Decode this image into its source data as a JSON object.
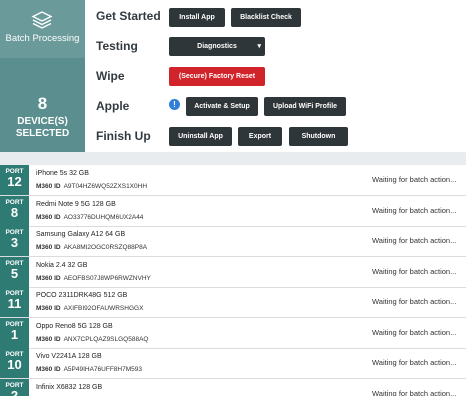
{
  "sidebar": {
    "app_label": "Batch Processing",
    "device_count": "8",
    "device_label_line1": "DEVICE(S)",
    "device_label_line2": "SELECTED"
  },
  "actions": {
    "get_started": {
      "label": "Get Started",
      "install_app": "Install App",
      "blacklist_check": "Blacklist Check"
    },
    "testing": {
      "label": "Testing",
      "diagnostics": "Diagnostics"
    },
    "wipe": {
      "label": "Wipe",
      "factory_reset": "(Secure) Factory Reset"
    },
    "apple": {
      "label": "Apple",
      "info": "!",
      "activate_setup": "Activate & Setup",
      "upload_wifi": "Upload WiFi Profile"
    },
    "finish_up": {
      "label": "Finish Up",
      "uninstall_app": "Uninstall App",
      "export": "Export",
      "shutdown": "Shutdown"
    }
  },
  "colors": {
    "sidebar": "#5b8e8e",
    "port_badge": "#2e7b74",
    "button_dark": "#2f3639",
    "button_danger": "#d0232a",
    "info_blue": "#2f7fd6"
  },
  "device_list": {
    "port_label": "PORT",
    "id_label": "M360 ID",
    "devices": [
      {
        "port": "12",
        "name": "iPhone 5s 32 GB",
        "id": "A9T04HZ6WQ52ZXS1X0HH",
        "status": "Waiting for batch action..."
      },
      {
        "port": "8",
        "name": "Redmi Note 9 5G 128 GB",
        "id": "AO33776DUHQM6UX2A44",
        "status": "Waiting for batch action..."
      },
      {
        "port": "3",
        "name": "Samsung Galaxy A12 64 GB",
        "id": "AKA8MI2OGC0RSZQ88P8A",
        "status": "Waiting for batch action..."
      },
      {
        "port": "5",
        "name": "Nokia 2.4 32 GB",
        "id": "AEOFBS07J8WP6RWZNVHY",
        "status": "Waiting for batch action..."
      },
      {
        "port": "11",
        "name": "POCO 2311DRK48G 512 GB",
        "id": "AXIFBI92OFAUWRSHGGX",
        "status": "Waiting for batch action..."
      },
      {
        "port": "1",
        "name": "Oppo Reno8 5G 128 GB",
        "id": "ANX7CPLQAZ9SLGQ588AQ",
        "status": "Waiting for batch action..."
      },
      {
        "port": "10",
        "name": "Vivo V2241A 128 GB",
        "id": "A5P49IHA76UFF8H7M593",
        "status": "Waiting for batch action..."
      },
      {
        "port": "2",
        "name": "Infinix X6832 128 GB",
        "id": "",
        "status": "Waiting for batch action..."
      }
    ]
  }
}
